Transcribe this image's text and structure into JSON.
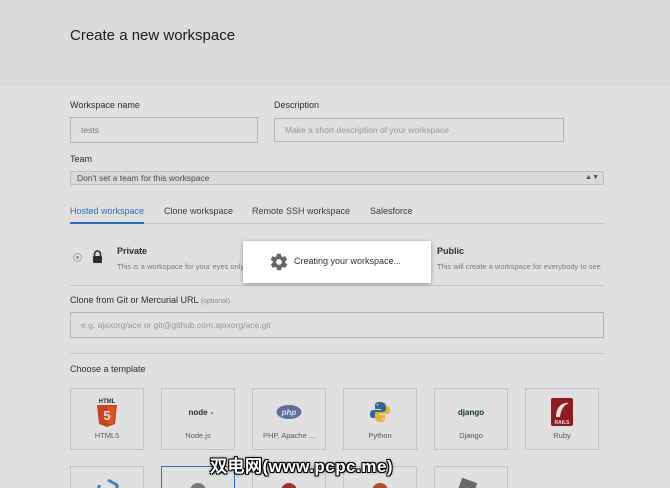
{
  "page": {
    "title": "Create a new workspace"
  },
  "form": {
    "workspace_name_label": "Workspace name",
    "workspace_name_value": "tests",
    "description_label": "Description",
    "description_placeholder": "Make a short description of your workspace",
    "team_label": "Team",
    "team_value": "Don't set a team for this workspace"
  },
  "tabs": [
    "Hosted workspace",
    "Clone workspace",
    "Remote SSH workspace",
    "Salesforce"
  ],
  "visibility": {
    "private": {
      "title": "Private",
      "desc": "This is a workspace for your eyes only"
    },
    "public": {
      "title": "Public",
      "desc": "This will create a workspace for everybody to see"
    }
  },
  "clone": {
    "label": "Clone from Git or Mercurial URL",
    "optional": "(optional)",
    "placeholder": "e.g. ajaxorg/ace or git@github.com:ajaxorg/ace.git"
  },
  "templates": {
    "label": "Choose a template",
    "items": [
      {
        "name": "HTML5",
        "icon": "html5-icon",
        "badge": "HTML"
      },
      {
        "name": "Node.js",
        "icon": "nodejs-icon",
        "badge": "node"
      },
      {
        "name": "PHP, Apache ...",
        "icon": "php-icon",
        "badge": "php"
      },
      {
        "name": "Python",
        "icon": "python-icon",
        "badge": ""
      },
      {
        "name": "Django",
        "icon": "django-icon",
        "badge": "django"
      },
      {
        "name": "Ruby",
        "icon": "rails-icon",
        "badge": "RAILS"
      }
    ]
  },
  "modal": {
    "text": "Creating your workspace..."
  },
  "watermark": "双电网(www.pcpc.me)",
  "colors": {
    "accent": "#2f7fd8",
    "header_bg": "#fafafa"
  }
}
